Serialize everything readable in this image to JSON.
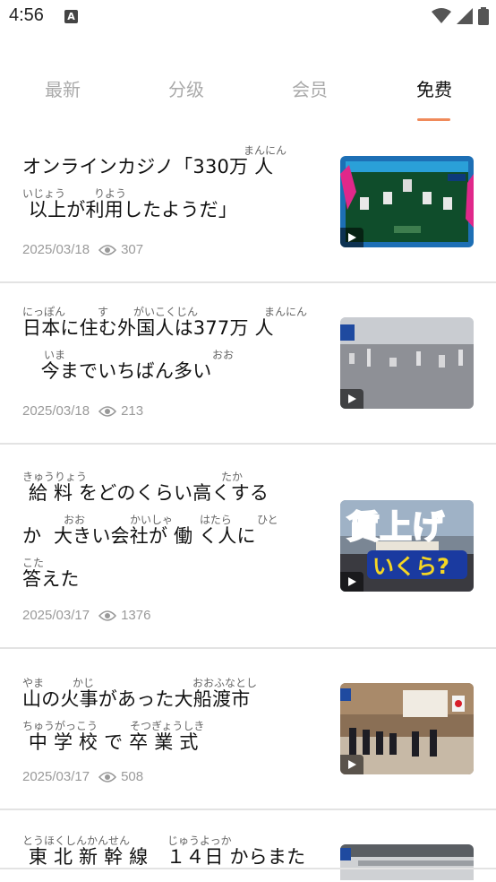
{
  "status": {
    "time": "4:56",
    "a_label": "A"
  },
  "tabs": [
    {
      "label": "最新",
      "active": false
    },
    {
      "label": "分级",
      "active": false
    },
    {
      "label": "会员",
      "active": false
    },
    {
      "label": "免费",
      "active": true
    }
  ],
  "colors": {
    "accent": "#f08a5a",
    "meta_gray": "#9a9a9a",
    "ruby_gray": "#666666"
  },
  "articles": [
    {
      "lines": [
        {
          "text": "オンラインカジノ「330万 人",
          "rubies": [
            "まんにん"
          ]
        },
        {
          "text": " 以上が利用したようだ」",
          "rubies": [
            "いじょう",
            "りよう"
          ]
        }
      ],
      "date": "2025/03/18",
      "views": "307"
    },
    {
      "lines": [
        {
          "text": "日本に住む外国人は377万 人",
          "rubies": [
            "にっぽん",
            "す",
            "がいこくじん",
            "まんにん"
          ]
        },
        {
          "text": "   今までいちばん多い",
          "rubies": [
            "いま",
            "おお"
          ]
        }
      ],
      "date": "2025/03/18",
      "views": "213"
    },
    {
      "lines": [
        {
          "text": " 給 料 をどのくらい高くする",
          "rubies": [
            "きゅうりょう",
            "たか"
          ]
        },
        {
          "text": "か  大きい会社が 働 く人に",
          "rubies": [
            "おお",
            "かいしゃ",
            "はたら",
            "ひと"
          ]
        },
        {
          "text": "答えた",
          "rubies": [
            "こた"
          ]
        }
      ],
      "date": "2025/03/17",
      "views": "1376"
    },
    {
      "lines": [
        {
          "text": "山の火事があった大船渡市",
          "rubies": [
            "やま",
            "かじ",
            "おおふなとし"
          ]
        },
        {
          "text": " 中 学 校 で 卒 業 式",
          "rubies": [
            "ちゅうがっこう",
            "そつぎょうしき"
          ]
        }
      ],
      "date": "2025/03/17",
      "views": "508"
    },
    {
      "lines": [
        {
          "text": " 東 北 新 幹 線   １４日 からまた",
          "rubies": [
            "とうほくしんかんせん",
            "じゅうよっか"
          ]
        }
      ],
      "date": "",
      "views": ""
    }
  ],
  "thumb3_text": {
    "line1": "賃上げ",
    "line2": "いくら?"
  },
  "icons": {
    "wifi": "wifi-icon",
    "signal": "signal-icon",
    "battery": "battery-icon",
    "eye": "eye-icon",
    "play": "play-icon"
  }
}
